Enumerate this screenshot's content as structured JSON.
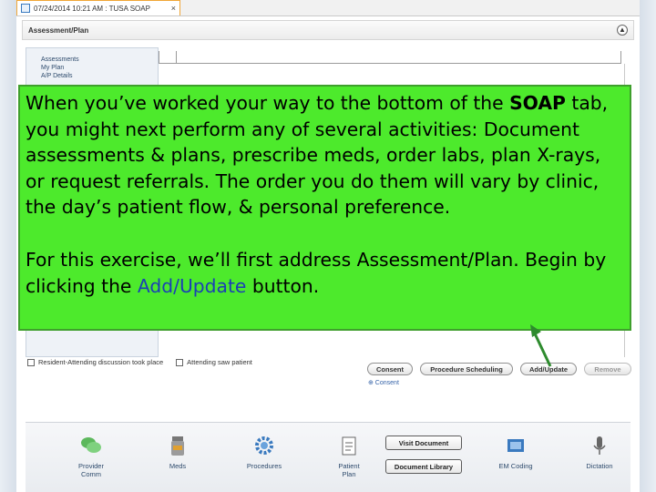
{
  "tab": {
    "title": "07/24/2014 10:21 AM : TUSA SOAP",
    "close": "×"
  },
  "section": {
    "title": "Assessment/Plan",
    "collapse_symbol": "▲"
  },
  "left_list": [
    "Assessments",
    "My Plan",
    "A/P Details"
  ],
  "checkboxes": [
    "Resident-Attending discussion took place",
    "Attending saw patient"
  ],
  "buttons": {
    "consent": "Consent",
    "procedure_scheduling": "Procedure Scheduling",
    "add_update": "Add/Update",
    "remove": "Remove"
  },
  "consent_link": "⊕ Consent",
  "bottom_tools": [
    {
      "label": "Provider\nComm",
      "icon": "chat-bubbles-icon"
    },
    {
      "label": "Meds",
      "icon": "pill-bottle-icon"
    },
    {
      "label": "Procedures",
      "icon": "gear-icon"
    },
    {
      "label": "Patient\nPlan",
      "icon": "clipboard-icon"
    },
    {
      "label": "EM Coding",
      "icon": "code-icon"
    },
    {
      "label": "Dictation",
      "icon": "microphone-icon"
    }
  ],
  "doc_buttons": {
    "visit_document": "Visit Document",
    "document_library": "Document Library"
  },
  "instruction": {
    "p1_a": "When you’ve worked your way to the bottom of the ",
    "p1_soap": "SOAP",
    "p1_b": " tab, you might next perform any of several activities: Document assessments & plans, prescribe meds, order labs, plan X-rays, or request referrals.  The order you do them will vary by clinic, the day’s patient flow, & personal preference.",
    "p2_a": "For this exercise, we’ll first address Assessment/Plan. Begin by clicking the ",
    "p2_link": "Add/Update",
    "p2_b": " button."
  },
  "colors": {
    "overlay_bg": "#4dea2c",
    "highlight": "#1b3fb6",
    "arrow": "#2e8b2e"
  }
}
